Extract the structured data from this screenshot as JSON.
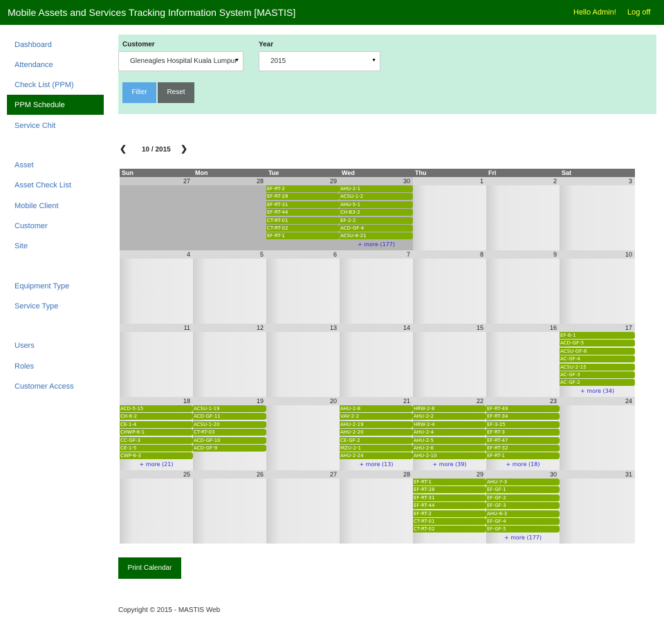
{
  "app": {
    "title": "Mobile Assets and Services Tracking Information System [MASTIS]",
    "greeting": "Hello Admin!",
    "logoff": "Log off"
  },
  "sidebar": {
    "items": [
      {
        "label": "Dashboard"
      },
      {
        "label": "Attendance"
      },
      {
        "label": "Check List (PPM)"
      },
      {
        "label": "PPM Schedule",
        "active": true
      },
      {
        "label": "Service Chit"
      },
      {
        "label": "Asset"
      },
      {
        "label": "Asset Check List"
      },
      {
        "label": "Mobile Client"
      },
      {
        "label": "Customer"
      },
      {
        "label": "Site"
      },
      {
        "label": "Equipment Type"
      },
      {
        "label": "Service Type"
      },
      {
        "label": "Users"
      },
      {
        "label": "Roles"
      },
      {
        "label": "Customer Access"
      }
    ]
  },
  "filter": {
    "customer_label": "Customer",
    "customer_value": "Gleneagles Hospital Kuala Lumpur",
    "year_label": "Year",
    "year_value": "2015",
    "filter_button": "Filter",
    "reset_button": "Reset"
  },
  "calendar": {
    "month_label": "10 / 2015",
    "prev_icon": "chevron-left-icon",
    "next_icon": "chevron-right-icon",
    "weekdays": [
      "Sun",
      "Mon",
      "Tue",
      "Wed",
      "Thu",
      "Fri",
      "Sat"
    ],
    "weeks": [
      [
        {
          "day": "27",
          "other": true,
          "events": []
        },
        {
          "day": "28",
          "other": true,
          "events": []
        },
        {
          "day": "29",
          "other": true,
          "events": [
            "EF-RT-2",
            "EF-RT-28",
            "EF-RT-31",
            "EF-RT-44",
            "CT-RT-01",
            "CT-RT-02",
            "EF-RT-1"
          ]
        },
        {
          "day": "30",
          "other": true,
          "events": [
            "AHU-2-1",
            "ACSU-1-2",
            "AHU-5-1",
            "CH-B3-2",
            "EF-2-2",
            "ACD-GF-4",
            "ACSU-8-21"
          ],
          "more": "+ more (177)"
        },
        {
          "day": "1",
          "events": []
        },
        {
          "day": "2",
          "events": []
        },
        {
          "day": "3",
          "events": []
        }
      ],
      [
        {
          "day": "4",
          "events": []
        },
        {
          "day": "5",
          "events": []
        },
        {
          "day": "6",
          "events": []
        },
        {
          "day": "7",
          "events": []
        },
        {
          "day": "8",
          "events": []
        },
        {
          "day": "9",
          "events": []
        },
        {
          "day": "10",
          "events": []
        }
      ],
      [
        {
          "day": "11",
          "events": []
        },
        {
          "day": "12",
          "events": []
        },
        {
          "day": "13",
          "events": []
        },
        {
          "day": "14",
          "events": []
        },
        {
          "day": "15",
          "events": []
        },
        {
          "day": "16",
          "events": []
        },
        {
          "day": "17",
          "events": [
            "EF-6-1",
            "ACD-GF-5",
            "ACSU-GF-8",
            "AC-GF-4",
            "ACSU-2-15",
            "AC-GF-3",
            "AC-GF-2"
          ],
          "more": "+ more (34)"
        }
      ],
      [
        {
          "day": "18",
          "events": [
            "ACD-5-15",
            "CH-6-2",
            "CE-1-4",
            "CHWP-6-1",
            "CC-GF-3",
            "CE-1-5",
            "CWP-6-3"
          ],
          "more": "+ more (21)"
        },
        {
          "day": "19",
          "events": [
            "ACSU-1-19",
            "ACD-GF-11",
            "ACSU-1-20",
            "CT-RT-03",
            "ACD-GF-10",
            "ACD-GF-9"
          ]
        },
        {
          "day": "20",
          "events": []
        },
        {
          "day": "21",
          "events": [
            "AHU-2-8",
            "VAV-2-2",
            "AHU-2-19",
            "AHU-2-20",
            "CE-GF-2",
            "MZU-2-1",
            "AHU-2-24"
          ],
          "more": "+ more (13)"
        },
        {
          "day": "22",
          "events": [
            "HRW-2-8",
            "AHU-2-2",
            "HRW-2-4",
            "AHU-2-4",
            "AHU-2-5",
            "AHU-2-6",
            "AHU-2-10"
          ],
          "more": "+ more (39)"
        },
        {
          "day": "23",
          "events": [
            "EF-RT-49",
            "EF-RT-34",
            "EF-3-25",
            "EF-RT-3",
            "EF-RT-47",
            "EF-RT-32",
            "EF-RT-1"
          ],
          "more": "+ more (18)"
        },
        {
          "day": "24",
          "events": []
        }
      ],
      [
        {
          "day": "25",
          "events": []
        },
        {
          "day": "26",
          "events": []
        },
        {
          "day": "27",
          "events": []
        },
        {
          "day": "28",
          "events": []
        },
        {
          "day": "29",
          "events": [
            "EF-RT-1",
            "EF-RT-28",
            "EF-RT-31",
            "EF-RT-44",
            "EF-RT-2",
            "CT-RT-01",
            "CT-RT-02"
          ]
        },
        {
          "day": "30",
          "events": [
            "AHU-7-3",
            "EF-GF-1",
            "EF-GF-2",
            "EF-GF-3",
            "AHU-6-3",
            "EF-GF-4",
            "EF-GF-5"
          ],
          "more": "+ more (177)"
        },
        {
          "day": "31",
          "events": []
        }
      ]
    ]
  },
  "print_button": "Print Calendar",
  "footer": "Copyright © 2015 - MASTIS Web",
  "colors": {
    "navbar": "#006400",
    "accent_yellow": "#ffff33",
    "event": "#7fae00",
    "filter_panel": "#c8eedd",
    "link": "#3b73b9"
  }
}
